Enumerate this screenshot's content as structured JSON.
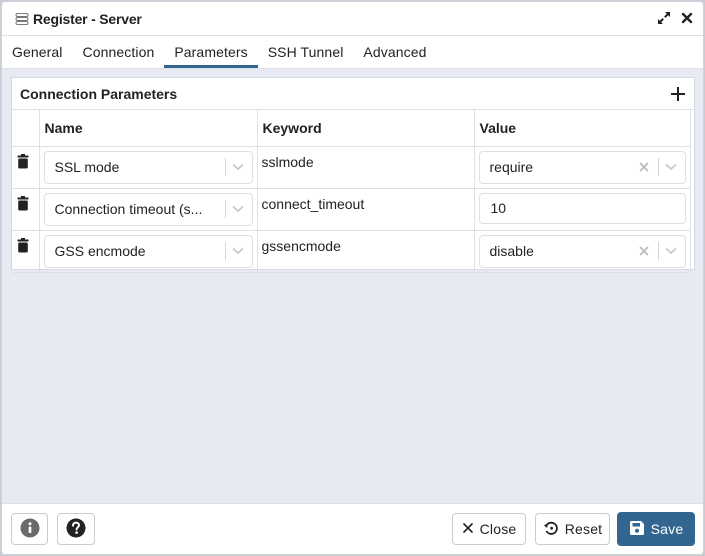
{
  "window": {
    "title": "Register - Server",
    "icons": {
      "app": "server-icon",
      "maximize": "expand-icon",
      "close": "close-icon"
    }
  },
  "tabs": [
    {
      "label": "General",
      "active": false
    },
    {
      "label": "Connection",
      "active": false
    },
    {
      "label": "Parameters",
      "active": true
    },
    {
      "label": "SSH Tunnel",
      "active": false
    },
    {
      "label": "Advanced",
      "active": false
    }
  ],
  "panel": {
    "title": "Connection Parameters",
    "add_icon": "plus-icon",
    "columns": [
      "",
      "Name",
      "Keyword",
      "Value"
    ],
    "rows": [
      {
        "name": "SSL mode",
        "keyword": "sslmode",
        "value": "require",
        "value_type": "select"
      },
      {
        "name": "Connection timeout (s...",
        "keyword": "connect_timeout",
        "value": "10",
        "value_type": "input"
      },
      {
        "name": "GSS encmode",
        "keyword": "gssencmode",
        "value": "disable",
        "value_type": "select"
      }
    ]
  },
  "footer": {
    "info_icon": "info-icon",
    "help_icon": "help-icon",
    "close_label": "Close",
    "reset_label": "Reset",
    "save_label": "Save"
  },
  "colors": {
    "accent": "#326690",
    "content_bg": "#e7eaf2",
    "border": "#dde0e6"
  }
}
